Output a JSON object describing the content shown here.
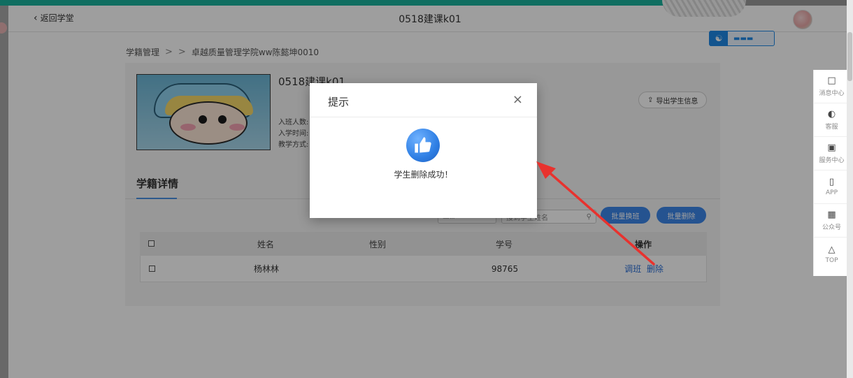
{
  "topbar": {
    "back_label": "返回学堂",
    "title": "0518建课k01"
  },
  "breadcrumb": {
    "root": "学籍管理",
    "current": "卓越质量管理学院ww陈懿坤0010"
  },
  "course": {
    "name": "0518建课k01",
    "meta": [
      "入班人数:",
      "入学时间:",
      "教学方式:"
    ],
    "export_label": "导出学生信息"
  },
  "section": {
    "title": "学籍详情"
  },
  "filters": {
    "select_value": "全部",
    "search_placeholder": "搜到学生姓名",
    "batch_transfer": "批量换班",
    "batch_delete": "批量删除"
  },
  "table": {
    "headers": {
      "name": "姓名",
      "gender": "性别",
      "id": "学号",
      "op": "操作"
    },
    "rows": [
      {
        "name": "杨林林",
        "gender": "",
        "id": "98765",
        "op_transfer": "调班",
        "op_delete": "删除"
      }
    ]
  },
  "right_rail": {
    "items": [
      {
        "label": "消息中心",
        "icon": "message-icon"
      },
      {
        "label": "客服",
        "icon": "headset-icon"
      },
      {
        "label": "服务中心",
        "icon": "service-icon"
      },
      {
        "label": "APP",
        "icon": "phone-icon"
      },
      {
        "label": "公众号",
        "icon": "qrcode-icon"
      },
      {
        "label": "TOP",
        "icon": "triangle-up-icon"
      }
    ]
  },
  "modal": {
    "title": "提示",
    "message": "学生删除成功！",
    "close": "×"
  },
  "colors": {
    "accent": "#3d86e8",
    "teal": "#1bb29d",
    "arrow": "#e8322e"
  }
}
